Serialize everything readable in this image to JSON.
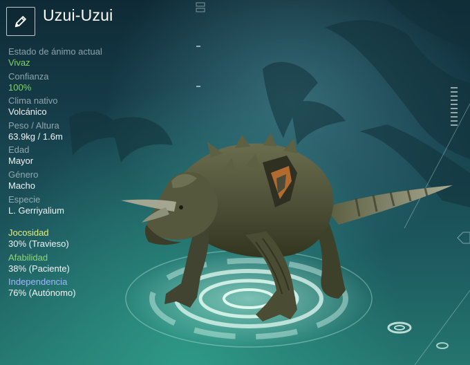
{
  "creature": {
    "name": "Uzui-Uzui"
  },
  "stats": {
    "mood": {
      "label": "Estado de ánimo actual",
      "value": "Vivaz"
    },
    "trust": {
      "label": "Confianza",
      "value": "100%"
    },
    "climate": {
      "label": "Clima nativo",
      "value": "Volcánico"
    },
    "size": {
      "label": "Peso / Altura",
      "value": "63.9kg / 1.6m"
    },
    "age": {
      "label": "Edad",
      "value": "Mayor"
    },
    "gender": {
      "label": "Género",
      "value": "Macho"
    },
    "species": {
      "label": "Especie",
      "value": "L. Gerriyalium"
    }
  },
  "personality": {
    "playfulness": {
      "label": "Jocosidad",
      "value": "30% (Travieso)"
    },
    "friendliness": {
      "label": "Afabilidad",
      "value": "38% (Paciente)"
    },
    "independence": {
      "label": "Independencia",
      "value": "76% (Autónomo)"
    }
  },
  "colors": {
    "highlight_green": "#7ed957",
    "playfulness_label": "#e6ef7a",
    "friendliness_label": "#8fd673",
    "independence_label": "#9fb8ff"
  },
  "icons": {
    "edit": "pencil-icon"
  }
}
